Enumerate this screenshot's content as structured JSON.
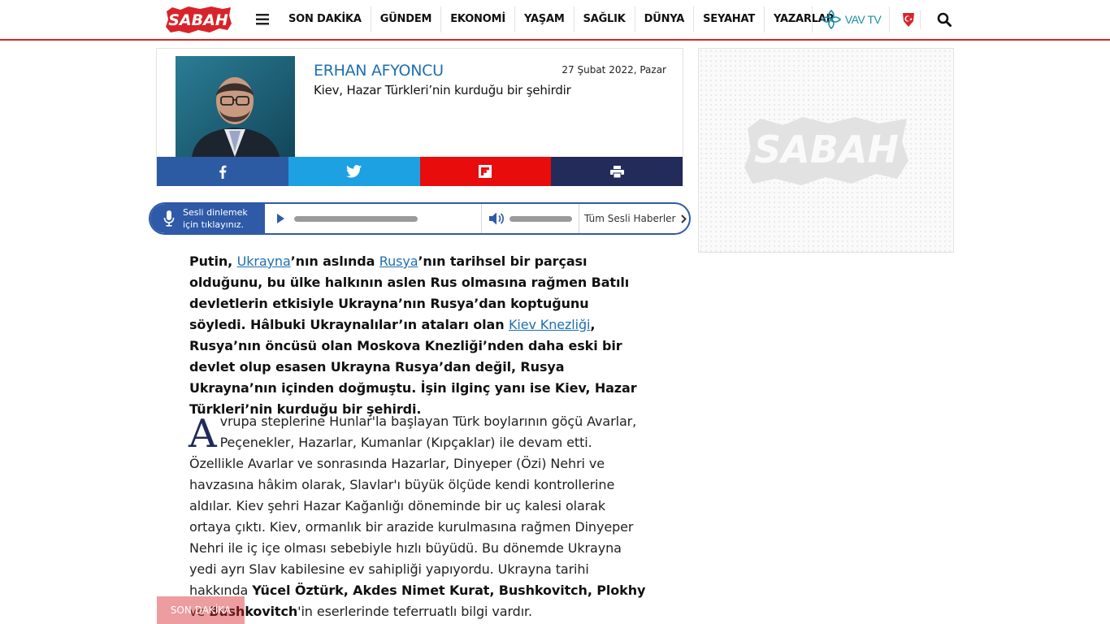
{
  "header": {
    "logo_text": "SABAH",
    "nav": [
      "SON DAKİKA",
      "GÜNDEM",
      "EKONOMİ",
      "YAŞAM",
      "SAĞLIK",
      "DÜNYA",
      "SEYAHAT",
      "YAZARLAR"
    ],
    "vavtv_label": "VAV TV",
    "icons": {
      "menu": "hamburger-icon",
      "vavtv": "vavtv-logo-icon",
      "flag": "turkish-flag-icon",
      "search": "search-icon"
    },
    "accent_color": "#d8232a"
  },
  "author": {
    "name": "ERHAN AFYONCU",
    "date": "27 Şubat 2022, Pazar",
    "article_title": "Kiev, Hazar Türkleri’nin kurduğu bir şehirdir"
  },
  "share": {
    "icons": [
      "facebook-icon",
      "twitter-icon",
      "flipboard-icon",
      "print-icon"
    ],
    "colors": [
      "#2c5ba3",
      "#1da1e2",
      "#e90c0c",
      "#232b5a"
    ]
  },
  "audio": {
    "listen_line1": "Sesli dinlemek",
    "listen_line2": "için tıklayınız.",
    "all_label": "Tüm Sesli Haberler",
    "progress": 0,
    "volume": 1
  },
  "lead": {
    "t1": "Putin, ",
    "link1": "Ukrayna",
    "t2": "’nın aslında ",
    "link2": "Rusya",
    "t3": "’nın tarihsel bir parçası olduğunu, bu ülke halkının aslen Rus olmasına rağmen Batılı devletlerin etkisiyle Ukrayna’nın Rusya’dan koptuğunu söyledi. Hâlbuki Ukraynalılar’ın ataları olan ",
    "link3": "Kiev Knezliği",
    "t4": ", Rusya’nın öncüsü olan Moskova Knezliği’nden daha eski bir devlet olup esasen Ukrayna Rusya’dan değil, Rusya Ukrayna’nın içinden doğmuştu. İşin ilginç yanı ise Kiev, Hazar Türkleri’nin kurduğu bir şehirdi."
  },
  "body": {
    "drop_cap": "A",
    "p1": "vrupa steplerine Hunlar'la başlayan Türk boylarının göçü Avarlar, Peçenekler, Hazarlar, Kumanlar (Kıpçaklar) ile devam etti. Özellikle Avarlar ve sonrasında Hazarlar, Dinyeper (Özi) Nehri ve havzasına hâkim olarak, Slavlar'ı büyük ölçüde kendi kontrollerine aldılar. Kiev şehri Hazar Kağanlığı döneminde bir uç kalesi olarak ortaya çıktı. Kiev, ormanlık bir arazide kurulmasına rağmen Dinyeper Nehri ile iç içe olması sebebiyle hızlı büyüdü. Bu dönemde Ukrayna yedi ayrı Slav kabilesine ev sahipliği yapıyordu. Ukrayna tarihi hakkında ",
    "b1": "Yücel Öztürk, Akdes Nimet Kurat, Bushkovitch, Plokhy",
    "p2": " ve ",
    "b2": "Bushkovitch",
    "p3": "'in eserlerinde teferruatlı bilgi vardır."
  },
  "ad": {
    "logo_text": "SABAH"
  },
  "breaking": {
    "label": "SON DAKİKA"
  }
}
